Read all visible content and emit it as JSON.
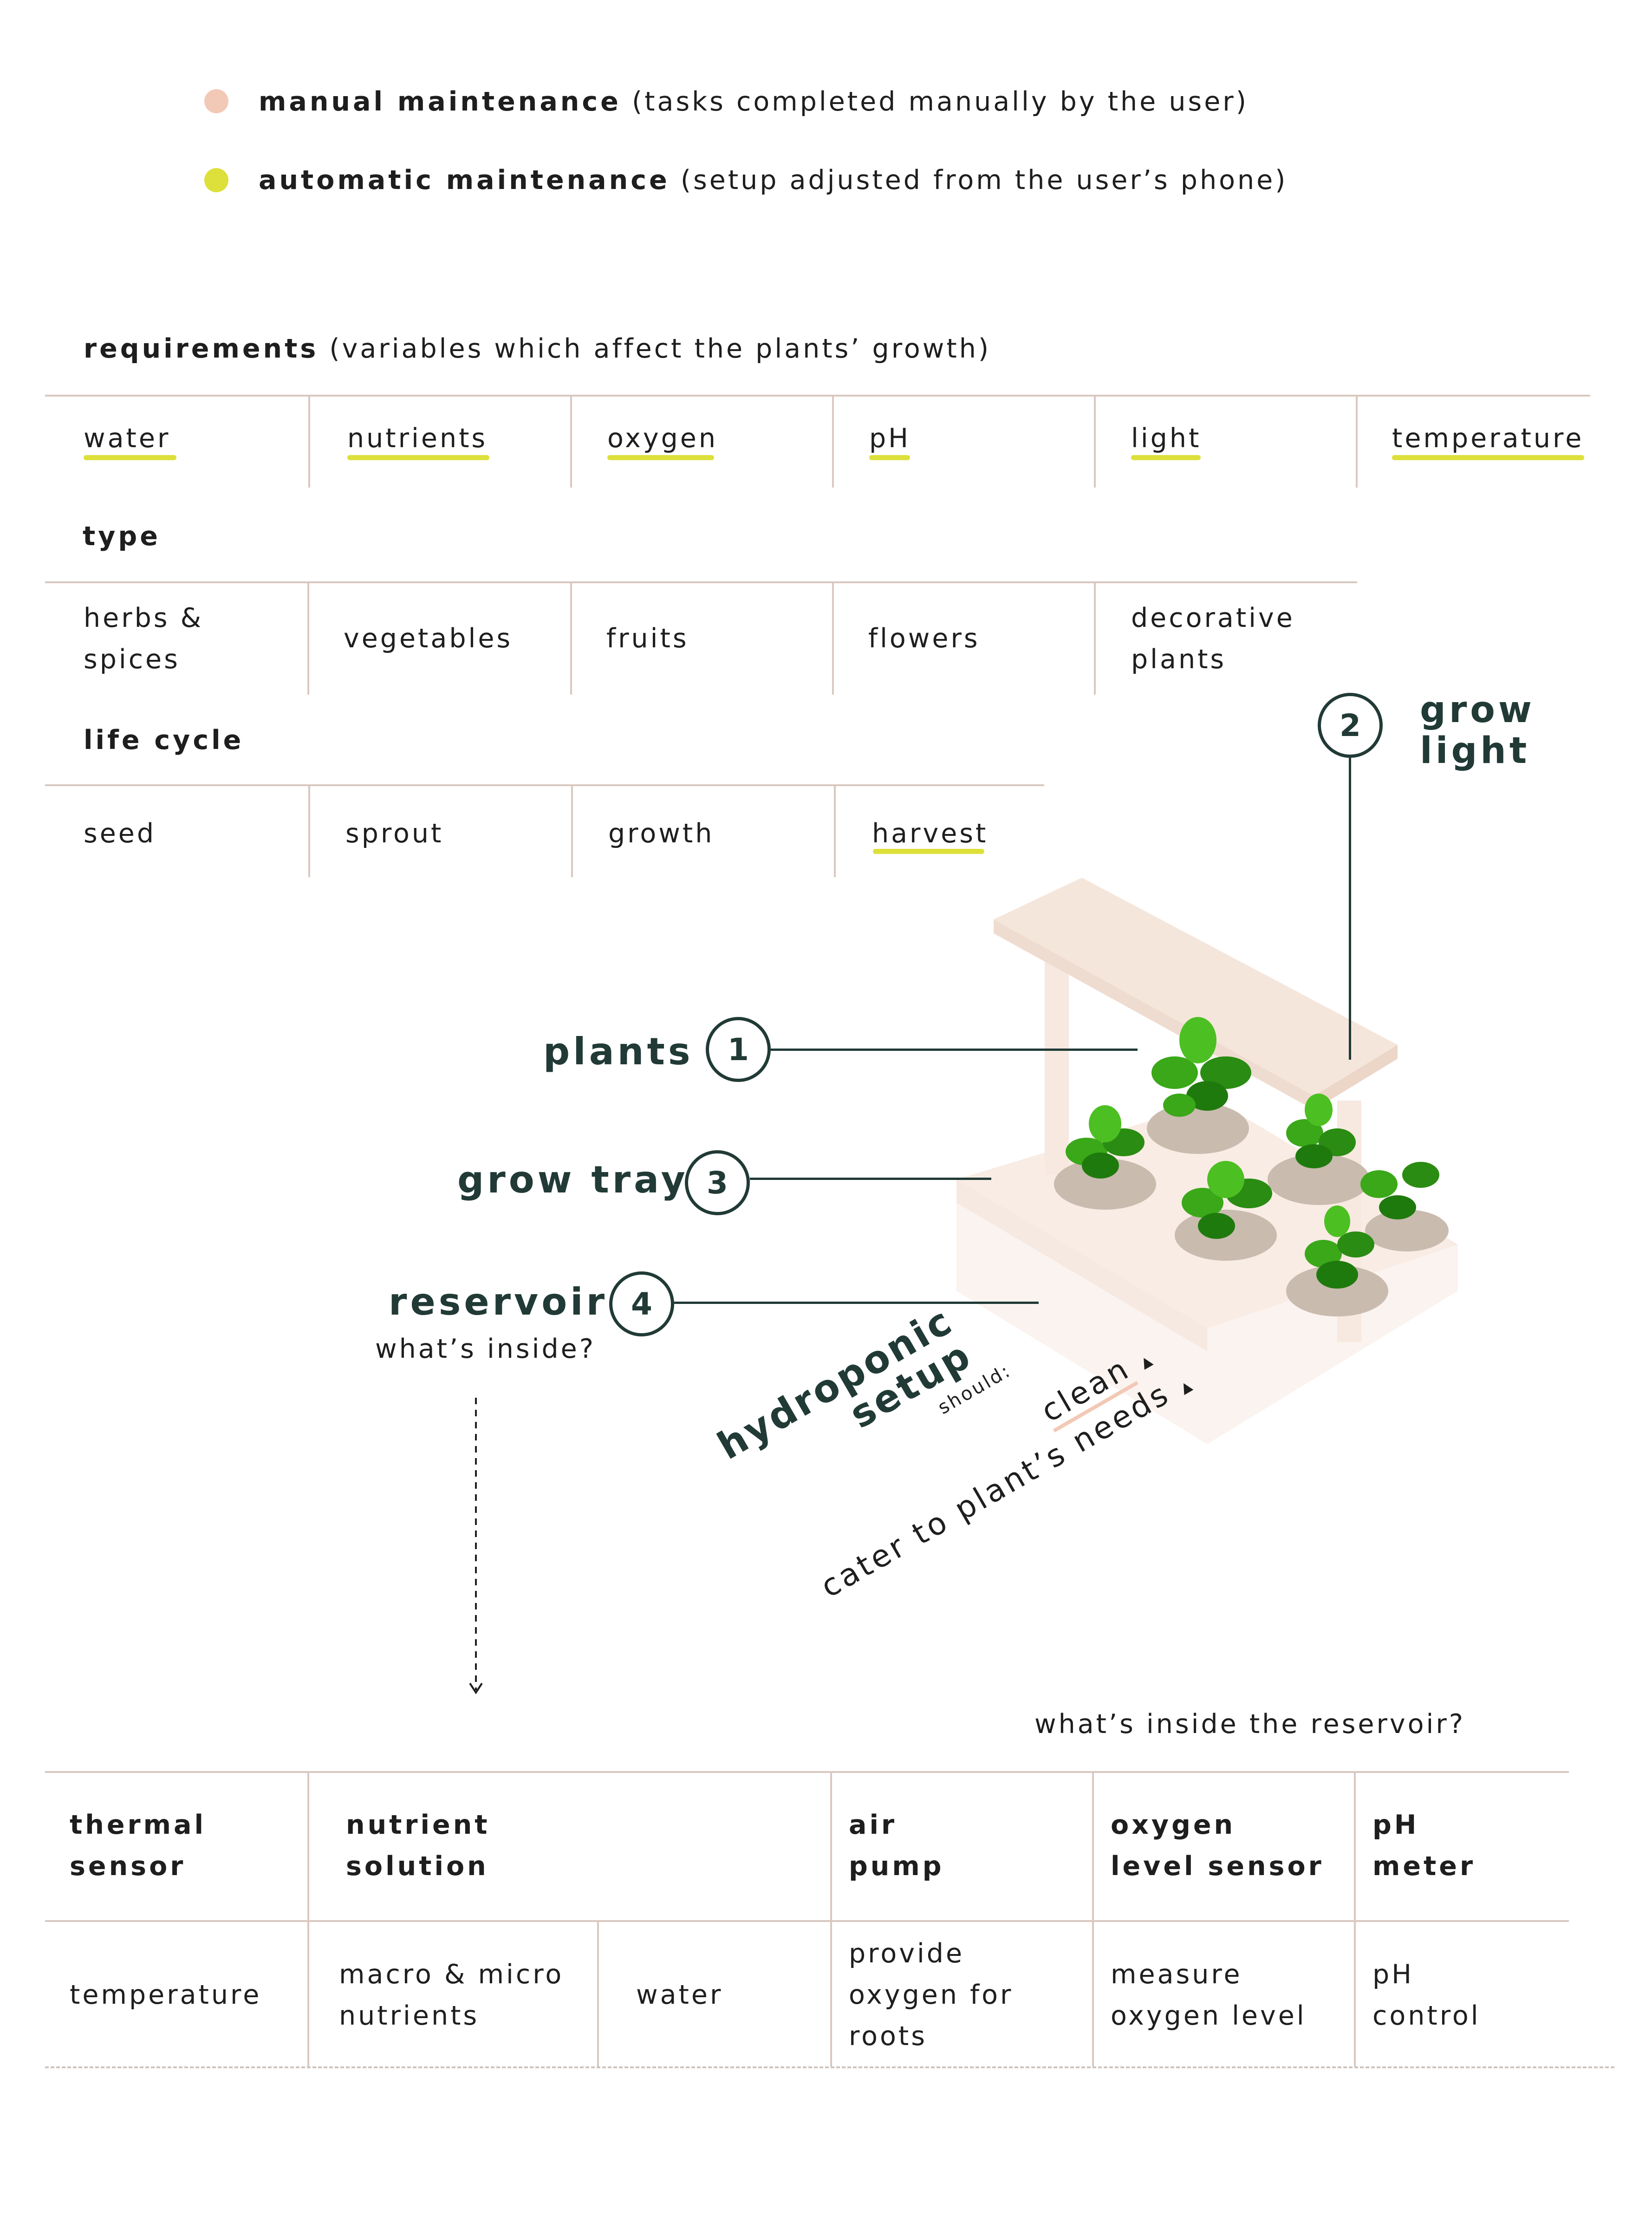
{
  "legend": {
    "manual": {
      "title": "manual maintenance",
      "desc": "(tasks completed manually by the user)",
      "color": "#f2c9b6"
    },
    "automatic": {
      "title": "automatic maintenance",
      "desc": "(setup adjusted from the user’s phone)",
      "color": "#dde03a"
    }
  },
  "requirements": {
    "title": "requirements",
    "desc": "(variables which affect the plants’ growth)",
    "items": [
      "water",
      "nutrients",
      "oxygen",
      "pH",
      "light",
      "temperature"
    ]
  },
  "type": {
    "title": "type",
    "items": [
      "herbs &",
      "spices",
      "vegetables",
      "fruits",
      "flowers",
      "decorative",
      "plants"
    ]
  },
  "life_cycle": {
    "title": "life cycle",
    "items": [
      "seed",
      "sprout",
      "growth",
      "harvest"
    ]
  },
  "callouts": {
    "plants": {
      "num": "1",
      "label": "plants"
    },
    "grow_light": {
      "num": "2",
      "label_line1": "grow",
      "label_line2": "light"
    },
    "grow_tray": {
      "num": "3",
      "label": "grow tray"
    },
    "reservoir": {
      "num": "4",
      "label": "reservoir",
      "sub": "what’s inside?"
    }
  },
  "setup_text": {
    "title_line1": "hydroponic",
    "title_line2": "setup",
    "should": "should:",
    "item1": "cater to plant’s needs",
    "item2": "clean"
  },
  "reservoir_table": {
    "caption": "what’s inside the reservoir?",
    "headers": [
      {
        "line1": "thermal",
        "line2": "sensor"
      },
      {
        "line1": "nutrient",
        "line2": "solution"
      },
      {
        "line1": "air",
        "line2": "pump"
      },
      {
        "line1": "oxygen",
        "line2": "level sensor"
      },
      {
        "line1": "pH",
        "line2": "meter"
      }
    ],
    "cells": [
      {
        "line1": "temperature",
        "line2": ""
      },
      {
        "line1": "macro & micro",
        "line2": "nutrients"
      },
      {
        "line1": "water",
        "line2": ""
      },
      {
        "line1": "provide",
        "line2": "oxygen for",
        "line3": "roots"
      },
      {
        "line1": "measure",
        "line2": "oxygen level"
      },
      {
        "line1": "pH",
        "line2": "control"
      }
    ]
  },
  "colors": {
    "accent_yellow": "#dde03a",
    "accent_peach": "#f2c9b6",
    "dark_teal": "#213a36",
    "divider": "#d9c8bf"
  }
}
